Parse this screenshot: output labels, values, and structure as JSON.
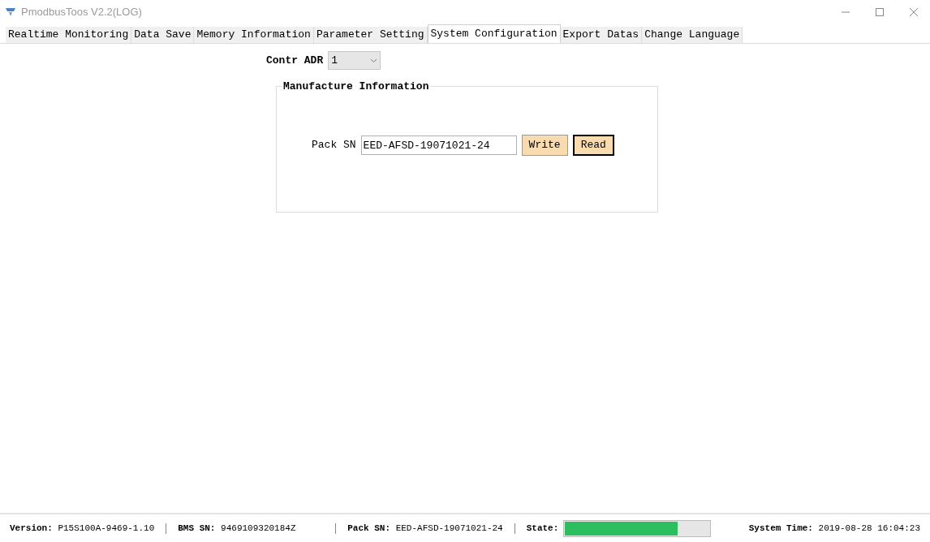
{
  "window": {
    "title": "PmodbusToos V2.2(LOG)"
  },
  "tabs": [
    {
      "label": "Realtime Monitoring",
      "selected": false
    },
    {
      "label": "Data Save",
      "selected": false
    },
    {
      "label": "Memory Information",
      "selected": false
    },
    {
      "label": "Parameter Setting",
      "selected": false
    },
    {
      "label": "System Configuration",
      "selected": true
    },
    {
      "label": "Export Datas",
      "selected": false
    },
    {
      "label": "Change Language",
      "selected": false
    }
  ],
  "controller_address": {
    "label": "Contr ADR",
    "value": "1"
  },
  "manufacture_group": {
    "title": "Manufacture Information",
    "field_label": "Pack SN",
    "field_value": "EED-AFSD-19071021-24",
    "buttons": [
      {
        "label": "Write",
        "focused": false
      },
      {
        "label": "Read",
        "focused": true
      }
    ]
  },
  "status_bar": {
    "version": {
      "label": "Version:",
      "value": "P15S100A-9469-1.10"
    },
    "bms_sn": {
      "label": "BMS SN:",
      "value": "9469109320184Z"
    },
    "pack_sn": {
      "label": "Pack SN:",
      "value": "EED-AFSD-19071021-24"
    },
    "state": {
      "label": "State:",
      "level": 0.78
    },
    "system_time": {
      "label": "System Time:",
      "value": "2019-08-28 16:04:23"
    }
  }
}
